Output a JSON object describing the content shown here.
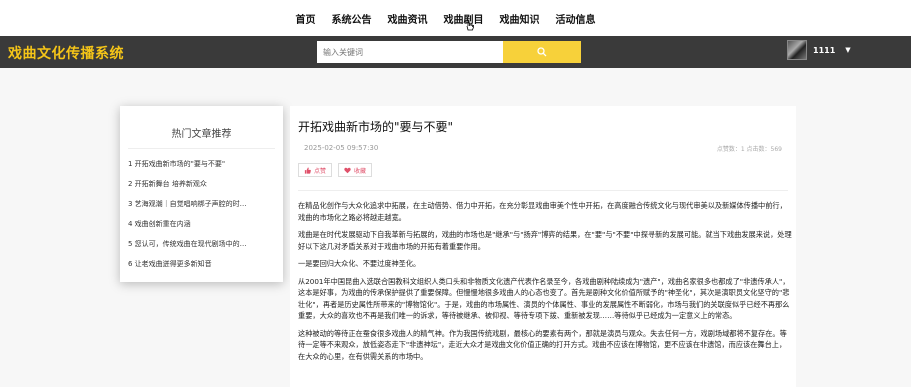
{
  "topnav": {
    "items": [
      "首页",
      "系统公告",
      "戏曲资讯",
      "戏曲剧目",
      "戏曲知识",
      "活动信息"
    ]
  },
  "header": {
    "brand": "戏曲文化传播系统",
    "search_placeholder": "输入关键词",
    "username": "1111"
  },
  "sidebar": {
    "title": "热门文章推荐",
    "items": [
      "1  开拓戏曲新市场的\"要与不要\"",
      "2  开拓新舞台 培养新观众",
      "3  艺海观潮｜自觉唱响梆子声腔的时…",
      "4  戏曲创新重在内涵",
      "5  您认可，传统戏曲在现代剧场中的…",
      "6  让老戏曲迸得更多新知音"
    ]
  },
  "article": {
    "title": "开拓戏曲新市场的\"要与不要\"",
    "date": "2025-02-05 09:57:30",
    "stats": "点赞数：1    点击数：569",
    "like_label": "点赞",
    "fav_label": "收藏",
    "paragraphs": [
      "在精品化创作与大众化追求中拓展，在主动借势、借力中开拓，在充分彰显戏曲审美个性中开拓，在高度融合传统文化与现代审美以及新媒体传播中前行，戏曲的市场化之路必将越走越宽。",
      "戏曲是在时代发展驱动下自我革新与拓展的，戏曲的市场也是\"继承\"与\"扬弃\"博弈的结果，在\"要\"与\"不要\"中探寻新的发展可能。就当下戏曲发展来说，处理好以下这几对矛盾关系对于戏曲市场的开拓有着重要作用。",
      "一是要回归大众化、不要过度神圣化。",
      "从2001年中国昆曲入选联合国教科文组织人类口头和非物质文化遗产代表作名录至今，各戏曲剧种陆续成为\"遗产\"，戏曲名家很多也都成了\"非遗传承人\"，这本是好事，为戏曲的传承保护提供了重要保障。但慢慢地很多戏曲人的心态也变了。首先是剧种文化价值所赋予的\"神圣化\"，其次是演职员文化坚守的\"悲壮化\"，再者是历史属性所带来的\"博物馆化\"。于是，戏曲的市场属性、演员的个体属性、事业的发展属性不断弱化，市场与我们的关联度似乎已经不再那么重要，大众的喜欢也不再是我们唯一的诉求，等待被继承、被仰视、等待专项下拨、重新被发现……等待似乎已经成为一定意义上的常态。",
      "这种被动的等待正在蚕食很多戏曲人的精气神。作为我国传统戏剧，最核心的要素有两个，那就是演员与观众。失去任何一方，戏剧场域都将不复存在。等待一定等不来观众，放低姿态走下\"非遗神坛\"，走近大众才是戏曲文化价值正确的打开方式。戏曲不应该在博物馆，更不应该在非遗馆，而应该在舞台上，在大众的心里，在有供需关系的市场中。"
    ]
  }
}
